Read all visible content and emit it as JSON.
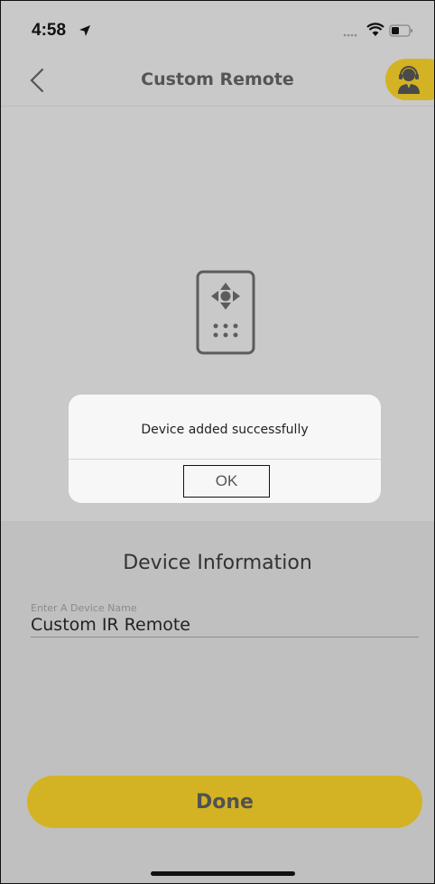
{
  "status_bar": {
    "time": "4:58",
    "icons": [
      "location-arrow-icon",
      "cellular-dots-icon",
      "wifi-icon",
      "battery-icon"
    ]
  },
  "nav": {
    "title": "Custom Remote",
    "back_icon": "chevron-left-icon",
    "support_icon": "customer-support-icon"
  },
  "main": {
    "icon": "remote-control-icon"
  },
  "alert": {
    "message": "Device added successfully",
    "ok_label": "OK"
  },
  "device_info": {
    "title": "Device Information",
    "name_field": {
      "label": "Enter A Device Name",
      "value": "Custom IR Remote"
    },
    "done_label": "Done"
  },
  "colors": {
    "accent": "#d3b323",
    "background": "#c9c9c9",
    "sheet": "#c0c0c0",
    "alert_bg": "#f7f7f7"
  }
}
